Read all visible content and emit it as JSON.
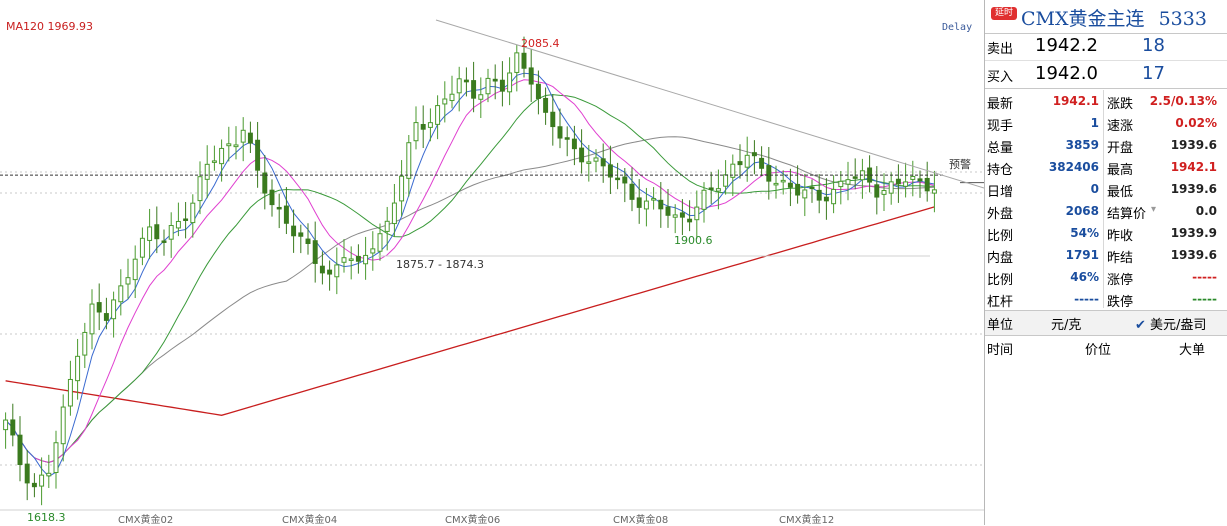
{
  "chart": {
    "ma_label": "MA120 1969.93",
    "delay_label": "Delay",
    "warn_label": "预警",
    "annotations": {
      "high": "2085.4",
      "low_start": "1618.3",
      "mid_low": "1900.6",
      "range_label": "1875.7 - 1874.3"
    },
    "x_labels": [
      "CMX黄金02",
      "CMX黄金04",
      "CMX黄金06",
      "CMX黄金08",
      "CMX黄金12"
    ],
    "colors": {
      "up": "#4a9a2e",
      "down": "#3a7a1e",
      "ma_red": "#c81e1e",
      "ma_magenta": "#e040d0",
      "ma_green": "#3a9a3a",
      "ma_gray": "#8a8a8a",
      "ma_blue": "#3a6ad0",
      "annot_red": "#d02020",
      "annot_green": "#2a8a2a"
    }
  },
  "chart_data": {
    "type": "candlestick",
    "title": "CMX黄金主连",
    "x_tick_labels": [
      "CMX黄金02",
      "CMX黄金04",
      "CMX黄金06",
      "CMX黄金08",
      "CMX黄金12"
    ],
    "ylim": [
      1600,
      2110
    ],
    "reference_lines": [
      {
        "name": "预警",
        "value": 1950
      },
      {
        "name": "last",
        "value": 1942.1
      }
    ],
    "annotated_values": {
      "high": 2085.4,
      "low": 1618.3,
      "swing_low": 1900.6,
      "range": [
        1875.7,
        1874.3
      ]
    },
    "indicators": [
      {
        "name": "MA120",
        "value": 1969.93
      }
    ],
    "close_path": [
      [
        0,
        1690
      ],
      [
        2,
        1650
      ],
      [
        4,
        1625
      ],
      [
        6,
        1640
      ],
      [
        8,
        1700
      ],
      [
        10,
        1770
      ],
      [
        12,
        1810
      ],
      [
        14,
        1800
      ],
      [
        16,
        1830
      ],
      [
        18,
        1870
      ],
      [
        20,
        1890
      ],
      [
        22,
        1880
      ],
      [
        24,
        1905
      ],
      [
        26,
        1920
      ],
      [
        28,
        1960
      ],
      [
        30,
        1975
      ],
      [
        32,
        1990
      ],
      [
        33,
        2000
      ],
      [
        35,
        1950
      ],
      [
        37,
        1920
      ],
      [
        39,
        1905
      ],
      [
        41,
        1880
      ],
      [
        43,
        1860
      ],
      [
        45,
        1845
      ],
      [
        47,
        1870
      ],
      [
        49,
        1850
      ],
      [
        51,
        1880
      ],
      [
        53,
        1900
      ],
      [
        55,
        1950
      ],
      [
        57,
        2000
      ],
      [
        59,
        2010
      ],
      [
        61,
        2030
      ],
      [
        63,
        2045
      ],
      [
        65,
        2035
      ],
      [
        67,
        2050
      ],
      [
        69,
        2040
      ],
      [
        71,
        2070
      ],
      [
        73,
        2055
      ],
      [
        75,
        2010
      ],
      [
        77,
        1990
      ],
      [
        79,
        1975
      ],
      [
        81,
        1970
      ],
      [
        83,
        1955
      ],
      [
        85,
        1945
      ],
      [
        87,
        1930
      ],
      [
        89,
        1920
      ],
      [
        91,
        1915
      ],
      [
        93,
        1905
      ],
      [
        95,
        1910
      ],
      [
        97,
        1925
      ],
      [
        99,
        1940
      ],
      [
        101,
        1960
      ],
      [
        103,
        1975
      ],
      [
        105,
        1950
      ],
      [
        107,
        1945
      ],
      [
        109,
        1940
      ],
      [
        111,
        1930
      ],
      [
        113,
        1925
      ],
      [
        115,
        1935
      ],
      [
        117,
        1950
      ],
      [
        119,
        1945
      ],
      [
        121,
        1935
      ],
      [
        123,
        1940
      ],
      [
        125,
        1945
      ],
      [
        127,
        1938
      ],
      [
        129,
        1942
      ]
    ]
  },
  "panel": {
    "badge": "延时",
    "title": "CMX黄金主连",
    "code": "5333",
    "sell": {
      "label": "卖出",
      "price": "1942.2",
      "volume": "18"
    },
    "buy": {
      "label": "买入",
      "price": "1942.0",
      "volume": "17"
    },
    "rows": [
      {
        "l1": "最新",
        "v1": "1942.1",
        "c1": "#d02020",
        "l2": "涨跌",
        "v2": "2.5/0.13%",
        "c2": "#d02020"
      },
      {
        "l1": "现手",
        "v1": "1",
        "c1": "#1a4d9e",
        "l2": "速涨",
        "v2": "0.02%",
        "c2": "#d02020"
      },
      {
        "l1": "总量",
        "v1": "3859",
        "c1": "#1a4d9e",
        "l2": "开盘",
        "v2": "1939.6",
        "c2": "#222222"
      },
      {
        "l1": "持仓",
        "v1": "382406",
        "c1": "#1a4d9e",
        "l2": "最高",
        "v2": "1942.1",
        "c2": "#d02020"
      },
      {
        "l1": "日增",
        "v1": "0",
        "c1": "#1a4d9e",
        "l2": "最低",
        "v2": "1939.6",
        "c2": "#222222"
      },
      {
        "l1": "外盘",
        "v1": "2068",
        "c1": "#1a4d9e",
        "l2": "结算价",
        "v2": "0.0",
        "c2": "#222222"
      },
      {
        "l1": "比例",
        "v1": "54%",
        "c1": "#1a4d9e",
        "l2": "昨收",
        "v2": "1939.9",
        "c2": "#222222"
      },
      {
        "l1": "内盘",
        "v1": "1791",
        "c1": "#1a4d9e",
        "l2": "昨结",
        "v2": "1939.6",
        "c2": "#222222"
      },
      {
        "l1": "比例",
        "v1": "46%",
        "c1": "#1a4d9e",
        "l2": "涨停",
        "v2": "-----",
        "c2": "#d02020"
      },
      {
        "l1": "杠杆",
        "v1": "-----",
        "c1": "#1a4d9e",
        "l2": "跌停",
        "v2": "-----",
        "c2": "#2a8a2a"
      }
    ],
    "unit_label": "单位",
    "unit_value": "元/克",
    "currency_option": "美元/盎司",
    "list_headers": [
      "时间",
      "价位",
      "大单"
    ]
  }
}
